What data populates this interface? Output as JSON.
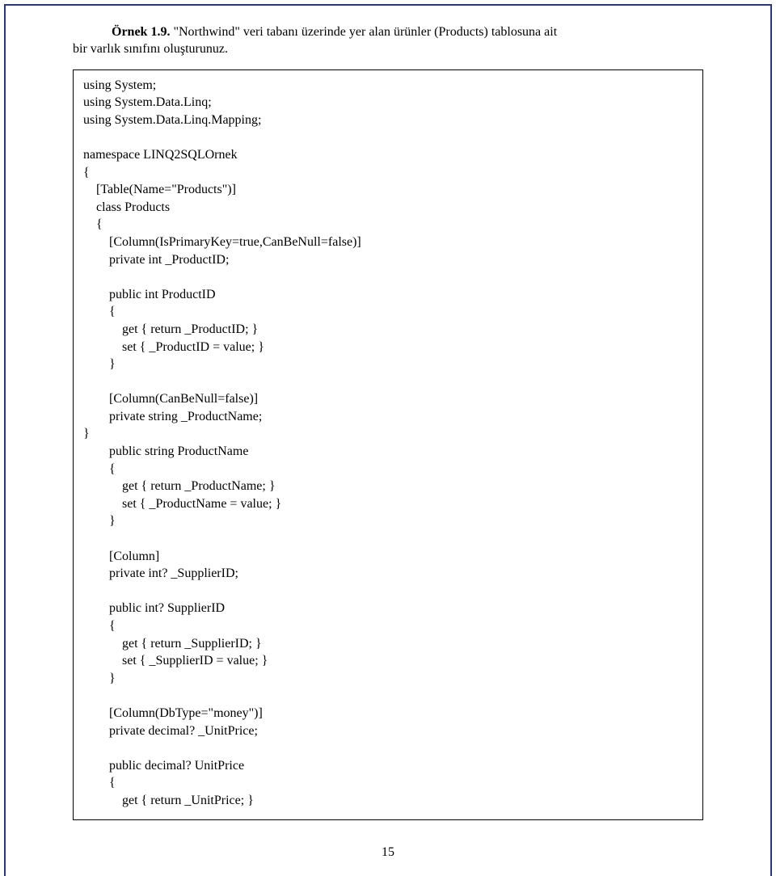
{
  "intro": {
    "example_label": "Örnek 1.9.",
    "rest_line1": " \"Northwind\" veri tabanı üzerinde yer alan ürünler (Products) tablosuna ait",
    "line2": "bir varlık sınıfını oluşturunuz."
  },
  "code": "using System;\nusing System.Data.Linq;\nusing System.Data.Linq.Mapping;\n\nnamespace LINQ2SQLOrnek\n{\n    [Table(Name=\"Products\")]\n    class Products\n    {\n        [Column(IsPrimaryKey=true,CanBeNull=false)]\n        private int _ProductID;\n\n        public int ProductID\n        {\n            get { return _ProductID; }\n            set { _ProductID = value; }\n        }\n\n        [Column(CanBeNull=false)]\n        private string _ProductName;\n}\n        public string ProductName\n        {\n            get { return _ProductName; }\n            set { _ProductName = value; }\n        }\n\n        [Column]\n        private int? _SupplierID;\n\n        public int? SupplierID\n        {\n            get { return _SupplierID; }\n            set { _SupplierID = value; }\n        }\n\n        [Column(DbType=\"money\")]\n        private decimal? _UnitPrice;\n\n        public decimal? UnitPrice\n        {\n            get { return _UnitPrice; }",
  "page_number": "15"
}
